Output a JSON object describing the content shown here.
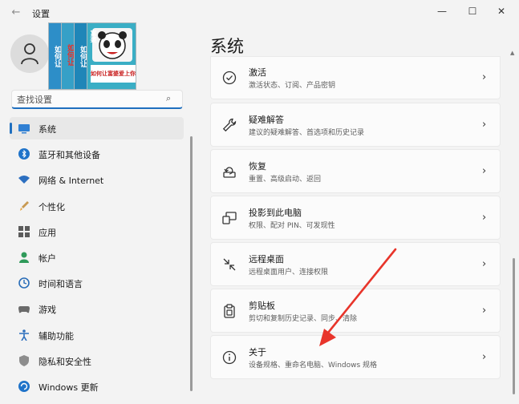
{
  "window": {
    "title": "设置",
    "back_icon": "←",
    "min_icon": "—",
    "max_icon": "☐",
    "close_icon": "✕"
  },
  "profile": {
    "book_spines": [
      "如何让",
      "如何让",
      "如何让"
    ],
    "book_cover_title": "如何让富婆爱上你",
    "book_cover_side": "富婆"
  },
  "search": {
    "placeholder": "查找设置",
    "icon": "⌕"
  },
  "nav": {
    "items": [
      {
        "label": "系统",
        "icon": "display-icon",
        "active": true
      },
      {
        "label": "蓝牙和其他设备",
        "icon": "bluetooth-icon"
      },
      {
        "label": "网络 & Internet",
        "icon": "wifi-icon"
      },
      {
        "label": "个性化",
        "icon": "brush-icon"
      },
      {
        "label": "应用",
        "icon": "apps-icon"
      },
      {
        "label": "帐户",
        "icon": "person-icon"
      },
      {
        "label": "时间和语言",
        "icon": "globe-clock-icon"
      },
      {
        "label": "游戏",
        "icon": "gamepad-icon"
      },
      {
        "label": "辅助功能",
        "icon": "accessibility-icon"
      },
      {
        "label": "隐私和安全性",
        "icon": "shield-icon"
      },
      {
        "label": "Windows 更新",
        "icon": "update-icon"
      }
    ]
  },
  "main": {
    "title": "系统",
    "chevron": "›",
    "cards": [
      {
        "title": "激活",
        "subtitle": "激活状态、订阅、产品密钥",
        "icon": "activation-icon"
      },
      {
        "title": "疑难解答",
        "subtitle": "建议的疑难解答、首选项和历史记录",
        "icon": "wrench-icon"
      },
      {
        "title": "恢复",
        "subtitle": "重置、高级启动、返回",
        "icon": "recovery-icon"
      },
      {
        "title": "投影到此电脑",
        "subtitle": "权限、配对 PIN、可发现性",
        "icon": "project-icon"
      },
      {
        "title": "远程桌面",
        "subtitle": "远程桌面用户、连接权限",
        "icon": "remote-desktop-icon"
      },
      {
        "title": "剪贴板",
        "subtitle": "剪切和复制历史记录、同步、清除",
        "icon": "clipboard-icon"
      },
      {
        "title": "关于",
        "subtitle": "设备规格、重命名电脑、Windows 规格",
        "icon": "info-icon"
      }
    ]
  },
  "colors": {
    "accent": "#1f6fbf",
    "annotation_arrow": "#e8352b"
  }
}
